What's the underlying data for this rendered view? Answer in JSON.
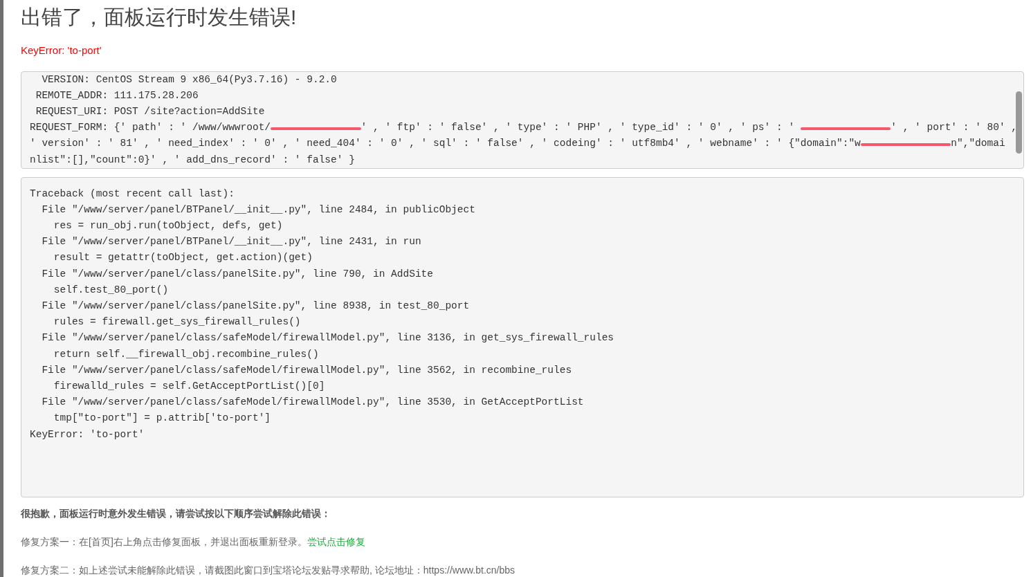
{
  "title": "出错了，面板运行时发生错误!",
  "error_message": "KeyError: 'to-port'",
  "request_info": {
    "lines": [
      [
        {
          "kind": "text",
          "text": "  VERSION: CentOS Stream 9 x86_64(Py3.7.16) - 9.2.0"
        }
      ],
      [
        {
          "kind": "text",
          "text": " REMOTE_ADDR: 111.175.28.206"
        }
      ],
      [
        {
          "kind": "text",
          "text": " REQUEST_URI: POST /site?action=AddSite"
        }
      ],
      [
        {
          "kind": "text",
          "text": "REQUEST_FORM: {' path' : ' /www/wwwroot/"
        },
        {
          "kind": "redacted"
        },
        {
          "kind": "text",
          "text": "' , ' ftp' : ' false' , ' type' : ' PHP' , ' type_id' : ' 0' , ' ps' : ' "
        },
        {
          "kind": "redacted"
        },
        {
          "kind": "text",
          "text": "' , ' port' : ' 80' ,"
        }
      ],
      [
        {
          "kind": "text",
          "text": "' version' : ' 81' , ' need_index' : ' 0' , ' need_404' : ' 0' , ' sql' : ' false' , ' codeing' : ' utf8mb4' , ' webname' : ' {\"domain\":\"w"
        },
        {
          "kind": "redacted"
        },
        {
          "kind": "text",
          "text": "n\",\"domai"
        }
      ],
      [
        {
          "kind": "text",
          "text": "nlist\":[],\"count\":0}' , ' add_dns_record' : ' false' }"
        }
      ]
    ]
  },
  "traceback": [
    "Traceback (most recent call last):",
    "  File \"/www/server/panel/BTPanel/__init__.py\", line 2484, in publicObject",
    "    res = run_obj.run(toObject, defs, get)",
    "  File \"/www/server/panel/BTPanel/__init__.py\", line 2431, in run",
    "    result = getattr(toObject, get.action)(get)",
    "  File \"/www/server/panel/class/panelSite.py\", line 790, in AddSite",
    "    self.test_80_port()",
    "  File \"/www/server/panel/class/panelSite.py\", line 8938, in test_80_port",
    "    rules = firewall.get_sys_firewall_rules()",
    "  File \"/www/server/panel/class/safeModel/firewallModel.py\", line 3136, in get_sys_firewall_rules",
    "    return self.__firewall_obj.recombine_rules()",
    "  File \"/www/server/panel/class/safeModel/firewallModel.py\", line 3562, in recombine_rules",
    "    firewalld_rules = self.GetAcceptPortList()[0]",
    "  File \"/www/server/panel/class/safeModel/firewallModel.py\", line 3530, in GetAcceptPortList",
    "    tmp[\"to-port\"] = p.attrib['to-port']",
    "KeyError: 'to-port'"
  ],
  "apology": "很抱歉，面板运行时意外发生错误，请尝试按以下顺序尝试解除此错误：",
  "solutions": [
    {
      "text": "修复方案一：在[首页]右上角点击修复面板，并退出面板重新登录。",
      "link": "尝试点击修复"
    },
    {
      "text": "修复方案二：如上述尝试未能解除此错误，请截图此窗口到宝塔论坛发贴寻求帮助, 论坛地址：https://www.bt.cn/bbs"
    }
  ]
}
